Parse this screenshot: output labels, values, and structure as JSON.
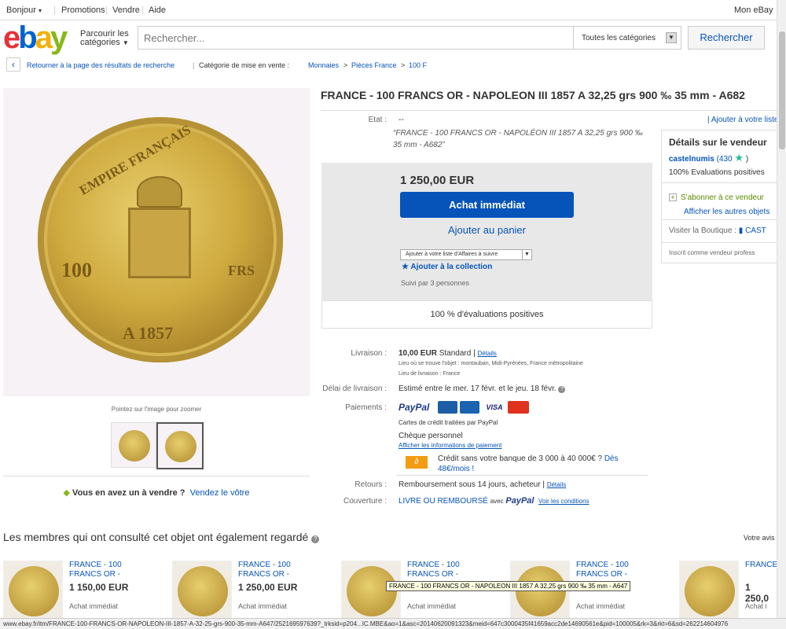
{
  "topnav": {
    "greeting": "Bonjour",
    "promotions": "Promotions",
    "sell": "Vendre",
    "help": "Aide",
    "myebay": "Mon eBay"
  },
  "header": {
    "shop_by_line1": "Parcourir les",
    "shop_by_line2": "catégories",
    "search_placeholder": "Rechercher...",
    "category": "Toutes les catégories",
    "search_button": "Rechercher"
  },
  "breadcrumb": {
    "back": "Retourner à la page des résultats de recherche",
    "listed_in": "Catégorie de mise en vente :",
    "c1": "Monnaies",
    "c2": "Pièces France",
    "c3": "100 F"
  },
  "image": {
    "zoom_hint": "Pointez sur l'image pour zoomer",
    "coin_top": "EMPIRE FRANÇAIS",
    "coin_left": "100",
    "coin_right": "FRS",
    "coin_bottom": "A 1857"
  },
  "sell": {
    "question": "Vous en avez un à vendre ?",
    "link": "Vendez le vôtre"
  },
  "listing": {
    "title": "FRANCE - 100 FRANCS OR - NAPOLEON III 1857 A 32,25 grs 900 ‰ 35 mm - A682",
    "condition_label": "Etat :",
    "condition_value": "--",
    "condition_desc": "“FRANCE - 100 FRANCS OR - NAPOLÉON III 1857 A 32,25 grs 900 ‰ 35 mm - A682”",
    "add_to_list": "Ajouter à votre liste",
    "price": "1 250,00 EUR",
    "buy_now": "Achat immédiat",
    "add_to_cart": "Ajouter au panier",
    "watch_select": "Ajouter à votre liste d'Affaires à suivre",
    "add_collection": "Ajouter à la collection",
    "followed_by": "Suivi par 3 personnes",
    "positive": "100 % d'évaluations positives"
  },
  "seller": {
    "heading": "Détails sur le vendeur",
    "name": "castelnumis",
    "score": "(430",
    "score_end": ")",
    "positive": "100% Evaluations positives",
    "subscribe": "S'abonner à ce vendeur",
    "other_items": "Afficher les autres objets",
    "visit_store": "Visiter la Boutique :",
    "store_name": "CAST",
    "since": "Inscrit comme vendeur profess"
  },
  "shipping": {
    "label": "Livraison :",
    "price": "10,00 EUR",
    "method": "Standard",
    "details": "Détails",
    "location": "Lieu où se trouve l'objet : montauban, Midi-Pyrénées, France métropolitaine",
    "ships_to": "Lieu de livraison : France",
    "delivery_label": "Délai de livraison :",
    "delivery": "Estimé entre le mer. 17 févr. et le jeu. 18 févr.",
    "payments_label": "Paiements :",
    "paypal": "PayPal",
    "visa": "VISA",
    "cards_note": "Cartes de crédit traitées par PayPal",
    "check": "Chèque personnel",
    "pay_info": "Afficher les informations de paiement",
    "credit_line1": "Crédit sans votre banque de 3 000 à 40 000€ ?",
    "credit_link_a": "Dès",
    "credit_link_b": "48€/mois !",
    "returns_label": "Retours :",
    "returns": "Remboursement sous 14 jours, acheteur |",
    "returns_details": "Détails",
    "coverage_label": "Couverture :",
    "coverage": "LIVRE OU REMBOURSÉ",
    "coverage_with": "avec",
    "conditions": "Voir les conditions"
  },
  "also": {
    "title": "Les membres qui ont consulté cet objet ont également regardé",
    "all": "Votre avis",
    "items": [
      {
        "title": "FRANCE - 100 FRANCS OR -",
        "price": "1 150,00 EUR",
        "buy": "Achat immédiat"
      },
      {
        "title": "FRANCE - 100 FRANCS OR -",
        "price": "1 250,00 EUR",
        "buy": "Achat immédiat"
      },
      {
        "title": "FRANCE - 100 FRANCS OR -",
        "price": "",
        "buy": "Achat immédiat"
      },
      {
        "title": "FRANCE - 100 FRANCS OR -",
        "price": "",
        "buy": "Achat immédiat"
      },
      {
        "title": "FRANCE",
        "price": "1 250,0",
        "buy": "Achat i"
      }
    ]
  },
  "tooltip": "FRANCE - 100 FRANCS OR - NAPOLEON III 1857 A 32,25 grs 900 ‰ 35 mm - A647",
  "status_url": "www.ebay.fr/itm/FRANCE-100-FRANCS-OR-NAPOLEON-III-1857-A-32-25-grs-900-35-mm-A647/252169597639?_trksid=p204...IC.MBE&ao=1&asc=20140620091323&meid=647c3000435f41659acc2de14690561e&pid=100005&rk=3&rkt=6&sd=262214604976"
}
